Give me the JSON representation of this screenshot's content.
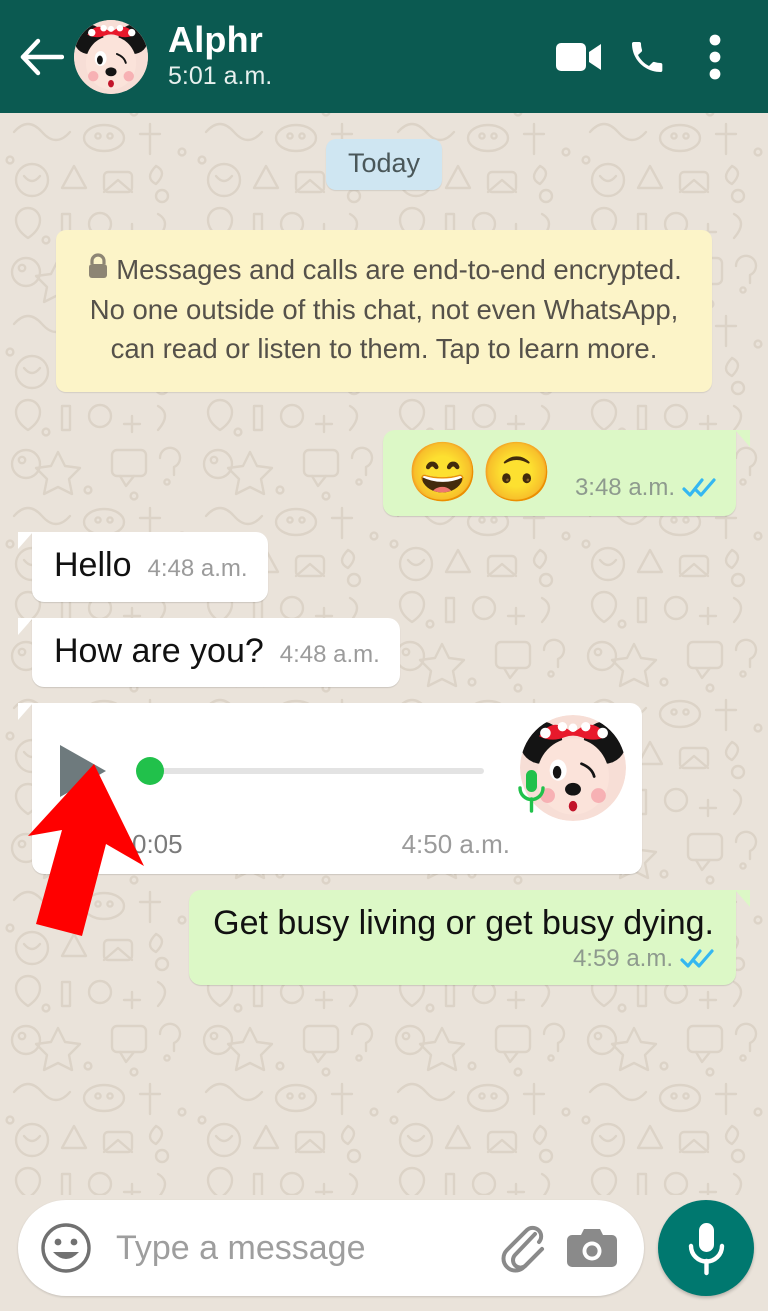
{
  "header": {
    "back_icon": "arrow-left-icon",
    "avatar_alt": "minnie-mouse-avatar",
    "title": "Alphr",
    "subtitle": "5:01 a.m.",
    "video_call_icon": "video-camera-icon",
    "voice_call_icon": "phone-icon",
    "menu_icon": "overflow-menu-icon",
    "bg_color": "#0B5A51"
  },
  "chat": {
    "day_badge": "Today",
    "encryption_notice": "Messages and calls are end-to-end encrypted. No one outside of this chat, not even WhatsApp, can read or listen to them. Tap to learn more.",
    "lock_icon": "lock-icon",
    "messages": [
      {
        "id": "msg-emoji",
        "direction": "out",
        "type": "emoji",
        "emoji": "😄🙃",
        "time": "3:48 a.m.",
        "status": "read"
      },
      {
        "id": "msg-hello",
        "direction": "in",
        "type": "text",
        "text": "Hello",
        "time": "4:48 a.m."
      },
      {
        "id": "msg-howareyou",
        "direction": "in",
        "type": "text",
        "text": "How are you?",
        "time": "4:48 a.m."
      },
      {
        "id": "msg-voice",
        "direction": "in",
        "type": "voice",
        "duration": "0:05",
        "time": "4:50 a.m.",
        "play_icon": "play-icon",
        "mic_icon": "microphone-icon",
        "progress_percent": 0
      },
      {
        "id": "msg-quote",
        "direction": "out",
        "type": "text-stacked",
        "text": "Get busy living or get busy dying.",
        "time": "4:59 a.m.",
        "status": "read"
      }
    ],
    "annotation_arrow": "red-arrow-up-annotation",
    "bubble_in_color": "#FFFFFF",
    "bubble_out_color": "#DCF8C6",
    "background_color": "#EAE3DA"
  },
  "composer": {
    "emoji_icon": "emoji-smiley-icon",
    "placeholder": "Type a message",
    "value": "",
    "attach_icon": "paperclip-icon",
    "camera_icon": "camera-icon",
    "mic_icon": "microphone-icon",
    "mic_button_color": "#00786F"
  }
}
